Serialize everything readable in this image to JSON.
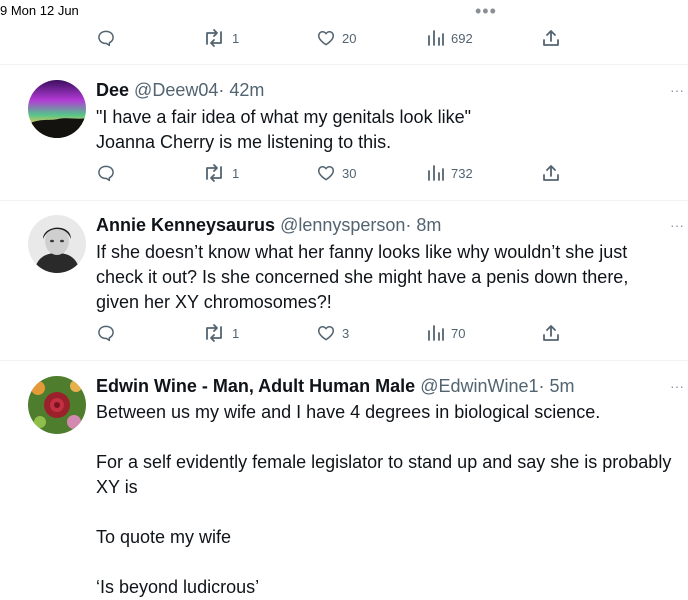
{
  "status_bar": {
    "time": "9  Mon 12 Jun",
    "menu_dots": "•••"
  },
  "icons": {
    "reply": "reply-bubble-icon",
    "retweet": "retweet-icon",
    "like": "heart-icon",
    "views": "bar-chart-icon",
    "share": "share-icon",
    "more": "more-dots-icon"
  },
  "top_actions": {
    "retweets": "1",
    "likes": "20",
    "views": "692"
  },
  "tweets": [
    {
      "name": "Dee",
      "handle": "@Deew04",
      "time": "· 42m",
      "more": "···",
      "lines": [
        "\"I have a fair idea of what my genitals look like\"",
        "Joanna Cherry is me listening to this."
      ],
      "retweets": "1",
      "likes": "30",
      "views": "732"
    },
    {
      "name": "Annie Kenneysaurus",
      "handle": "@lennysperson",
      "time": "· 8m",
      "more": "···",
      "lines": [
        "If she doesn’t know what her fanny looks like why wouldn’t she just",
        "check it out? Is she concerned she might have a penis down there,",
        "given her XY chromosomes?!"
      ],
      "retweets": "1",
      "likes": "3",
      "views": "70"
    },
    {
      "name": "Edwin Wine - Man, Adult Human Male",
      "handle": "@EdwinWine1",
      "time": "· 5m",
      "more": "···",
      "paragraphs": [
        "Between us my wife and I have 4 degrees in biological science.",
        "For a self evidently female legislator to stand up and say she is probably",
        "XY is",
        "To quote my wife",
        "‘Is beyond ludicrous’"
      ]
    }
  ]
}
